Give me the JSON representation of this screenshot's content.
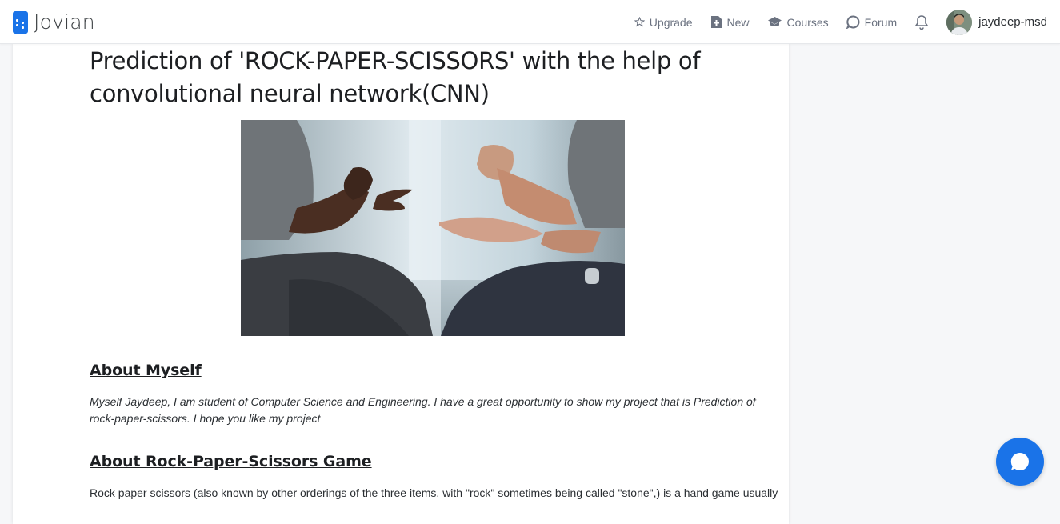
{
  "brand": {
    "name": "Jovian"
  },
  "nav": {
    "upgrade": "Upgrade",
    "new": "New",
    "courses": "Courses",
    "forum": "Forum",
    "username": "jaydeep-msd"
  },
  "article": {
    "title": "Prediction of 'ROCK-PAPER-SCISSORS' with the help of convolutional neural network(CNN)",
    "section1": {
      "heading": "About Myself",
      "body": "Myself Jaydeep, I am student of Computer Science and Engineering. I have a great opportunity to show my project that is Prediction of rock-paper-scissors. I hope you like my project"
    },
    "section2": {
      "heading": "About Rock-Paper-Scissors Game",
      "body": "Rock paper scissors (also known by other orderings of the three items, with \"rock\" sometimes being called \"stone\",) is a hand game usually"
    }
  },
  "icons": {
    "brand": "jovian-logo-icon",
    "upgrade": "star-icon",
    "new": "new-file-icon",
    "courses": "graduation-cap-icon",
    "forum": "chat-bubble-icon",
    "notifications": "bell-icon",
    "chat": "chat-icon"
  },
  "colors": {
    "accent": "#1a73e8"
  }
}
